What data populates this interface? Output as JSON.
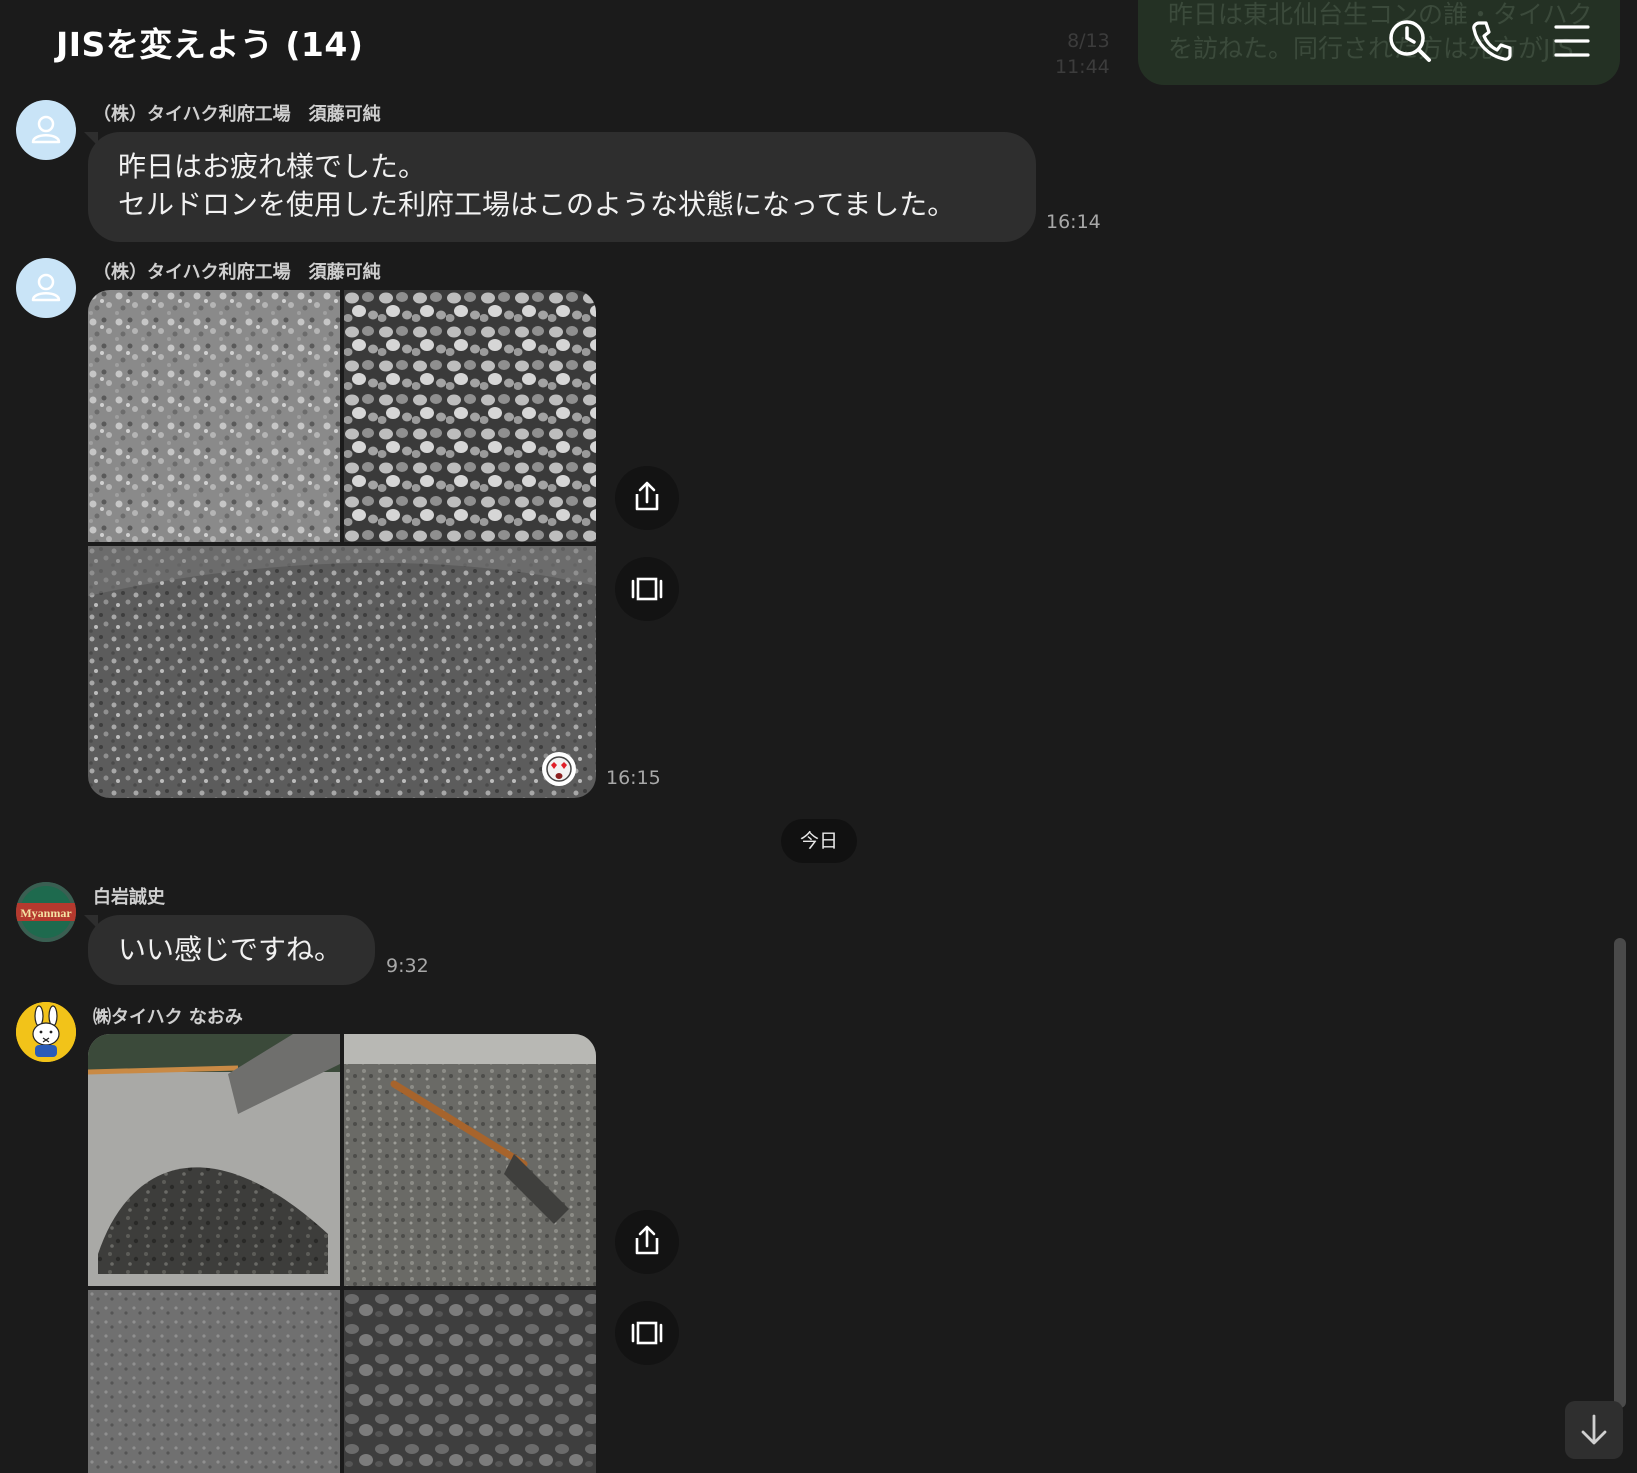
{
  "header": {
    "title": "JISを変えよう (14)",
    "ghost_time_1": "8/13",
    "ghost_time_2": "11:44",
    "ghost_line_1": "昨日は東北仙台生コンの誰・タイハク",
    "ghost_line_2": "を訪ねた。同行された方は先方がJIS",
    "icons": [
      "clock-search-icon",
      "phone-icon",
      "menu-icon"
    ]
  },
  "messages": [
    {
      "sender": "（株）タイハク利府工場　須藤可純",
      "line1": "昨日はお疲れ様でした。",
      "line2": "セルドロンを使用した利府工場はこのような状態になってました。",
      "time": "16:14"
    },
    {
      "sender": "（株）タイハク利府工場　須藤可純",
      "time": "16:15"
    },
    {
      "date_label": "今日"
    },
    {
      "sender": "白岩誠史",
      "avatar_text": "Myanmar",
      "text": "いい感じですね。",
      "time": "9:32"
    },
    {
      "sender": "㈱タイハク なおみ"
    }
  ],
  "colors": {
    "background": "#1b1b1b",
    "bubble": "#2e2e2e",
    "avatar_default": "#c9e4f7",
    "ghost_bubble": "#243124"
  }
}
